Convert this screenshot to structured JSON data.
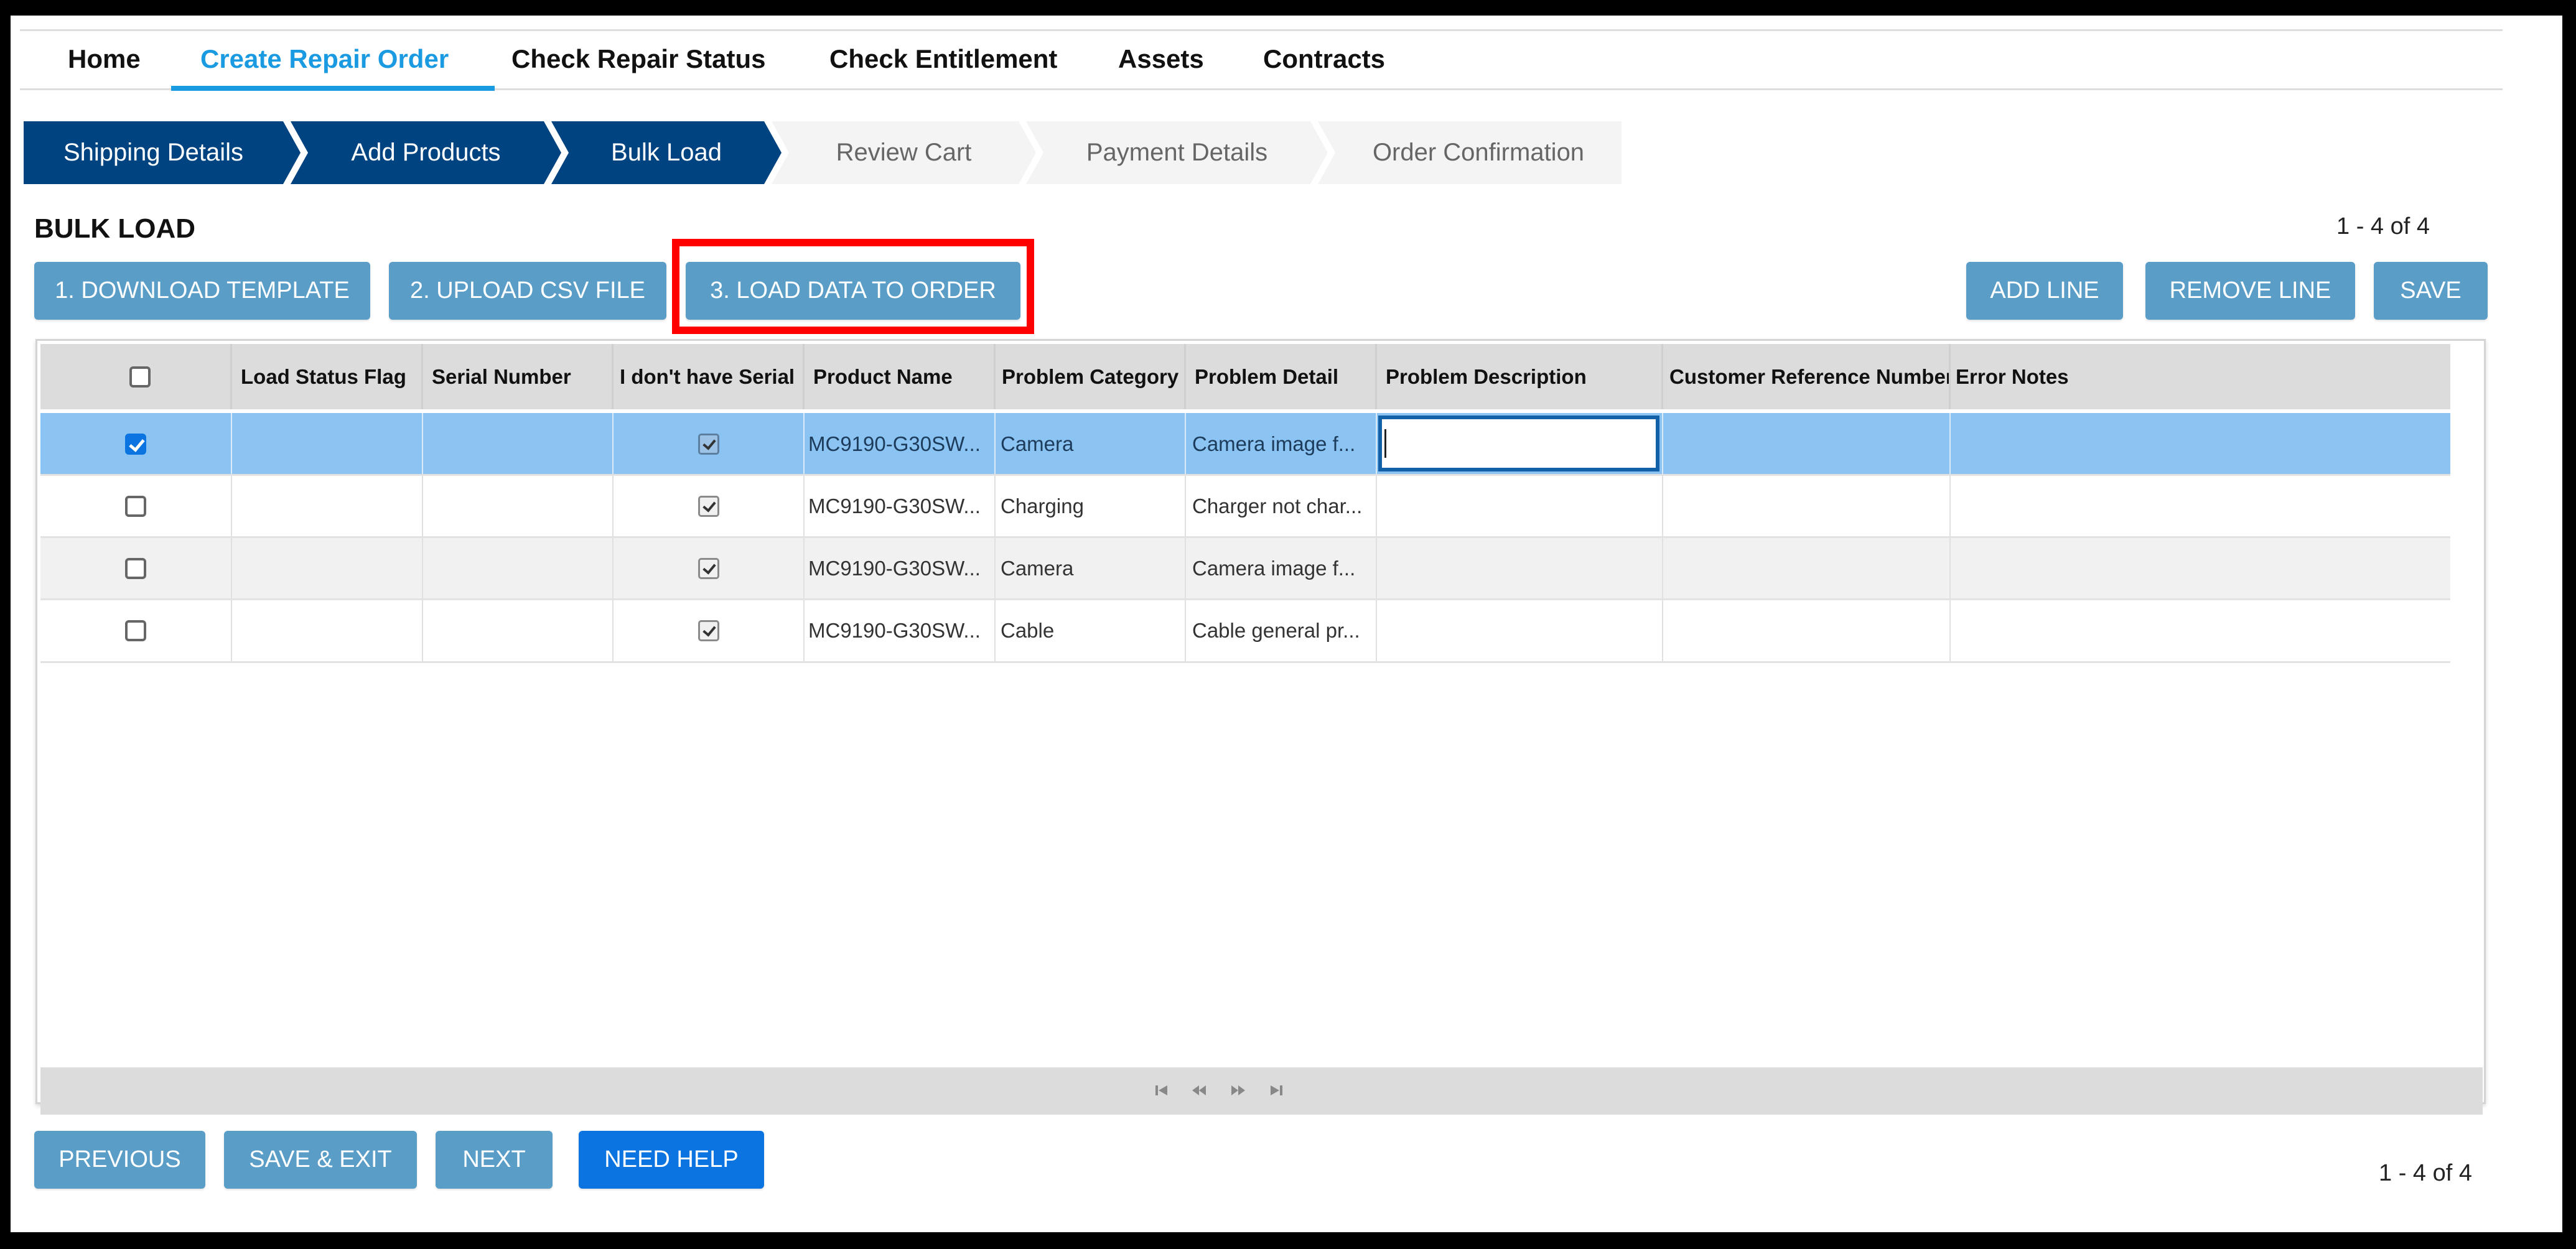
{
  "nav": {
    "items": [
      {
        "label": "Home",
        "active": false
      },
      {
        "label": "Create Repair Order",
        "active": true
      },
      {
        "label": "Check Repair Status",
        "active": false
      },
      {
        "label": "Check Entitlement",
        "active": false
      },
      {
        "label": "Assets",
        "active": false
      },
      {
        "label": "Contracts",
        "active": false
      }
    ]
  },
  "steps": [
    {
      "label": "Shipping Details",
      "state": "done"
    },
    {
      "label": "Add Products",
      "state": "done"
    },
    {
      "label": "Bulk Load",
      "state": "current"
    },
    {
      "label": "Review Cart",
      "state": "todo"
    },
    {
      "label": "Payment Details",
      "state": "todo"
    },
    {
      "label": "Order Confirmation",
      "state": "todo"
    }
  ],
  "section": {
    "title": "BULK LOAD",
    "count_label": "1 - 4 of 4"
  },
  "toolbar": {
    "download_template": "1. DOWNLOAD TEMPLATE",
    "upload_csv": "2. UPLOAD CSV FILE",
    "load_data": "3. LOAD DATA TO ORDER",
    "add_line": "ADD LINE",
    "remove_line": "REMOVE LINE",
    "save": "SAVE"
  },
  "table": {
    "columns": [
      "",
      "Load Status Flag",
      "Serial Number",
      "I don't have Serial",
      "Product Name",
      "Problem Category",
      "Problem Detail",
      "Problem Description",
      "Customer Reference Number",
      "Error Notes"
    ],
    "rows": [
      {
        "selected": true,
        "load_status_flag": "",
        "serial_number": "",
        "no_serial": true,
        "product_name": "MC9190-G30SW...",
        "problem_category": "Camera",
        "problem_detail": "Camera image f...",
        "problem_description": "",
        "customer_reference_number": "",
        "error_notes": ""
      },
      {
        "selected": false,
        "load_status_flag": "",
        "serial_number": "",
        "no_serial": true,
        "product_name": "MC9190-G30SW...",
        "problem_category": "Charging",
        "problem_detail": "Charger not char...",
        "problem_description": "",
        "customer_reference_number": "",
        "error_notes": ""
      },
      {
        "selected": false,
        "load_status_flag": "",
        "serial_number": "",
        "no_serial": true,
        "product_name": "MC9190-G30SW...",
        "problem_category": "Camera",
        "problem_detail": "Camera image f...",
        "problem_description": "",
        "customer_reference_number": "",
        "error_notes": ""
      },
      {
        "selected": false,
        "load_status_flag": "",
        "serial_number": "",
        "no_serial": true,
        "product_name": "MC9190-G30SW...",
        "problem_category": "Cable",
        "problem_detail": "Cable general pr...",
        "problem_description": "",
        "customer_reference_number": "",
        "error_notes": ""
      }
    ],
    "header_select_all": false,
    "pager_icons": [
      "first-page-icon",
      "prev-page-icon",
      "next-page-icon",
      "last-page-icon"
    ]
  },
  "footer": {
    "previous": "PREVIOUS",
    "save_exit": "SAVE & EXIT",
    "next": "NEXT",
    "need_help": "NEED HELP",
    "count_label": "1 - 4 of 4"
  },
  "colors": {
    "accent": "#1a9ae0",
    "step_done": "#004381",
    "button": "#5a9ec8",
    "button_primary": "#0b74e0",
    "row_selected": "#8bc4f2",
    "highlight": "#ff0000"
  }
}
